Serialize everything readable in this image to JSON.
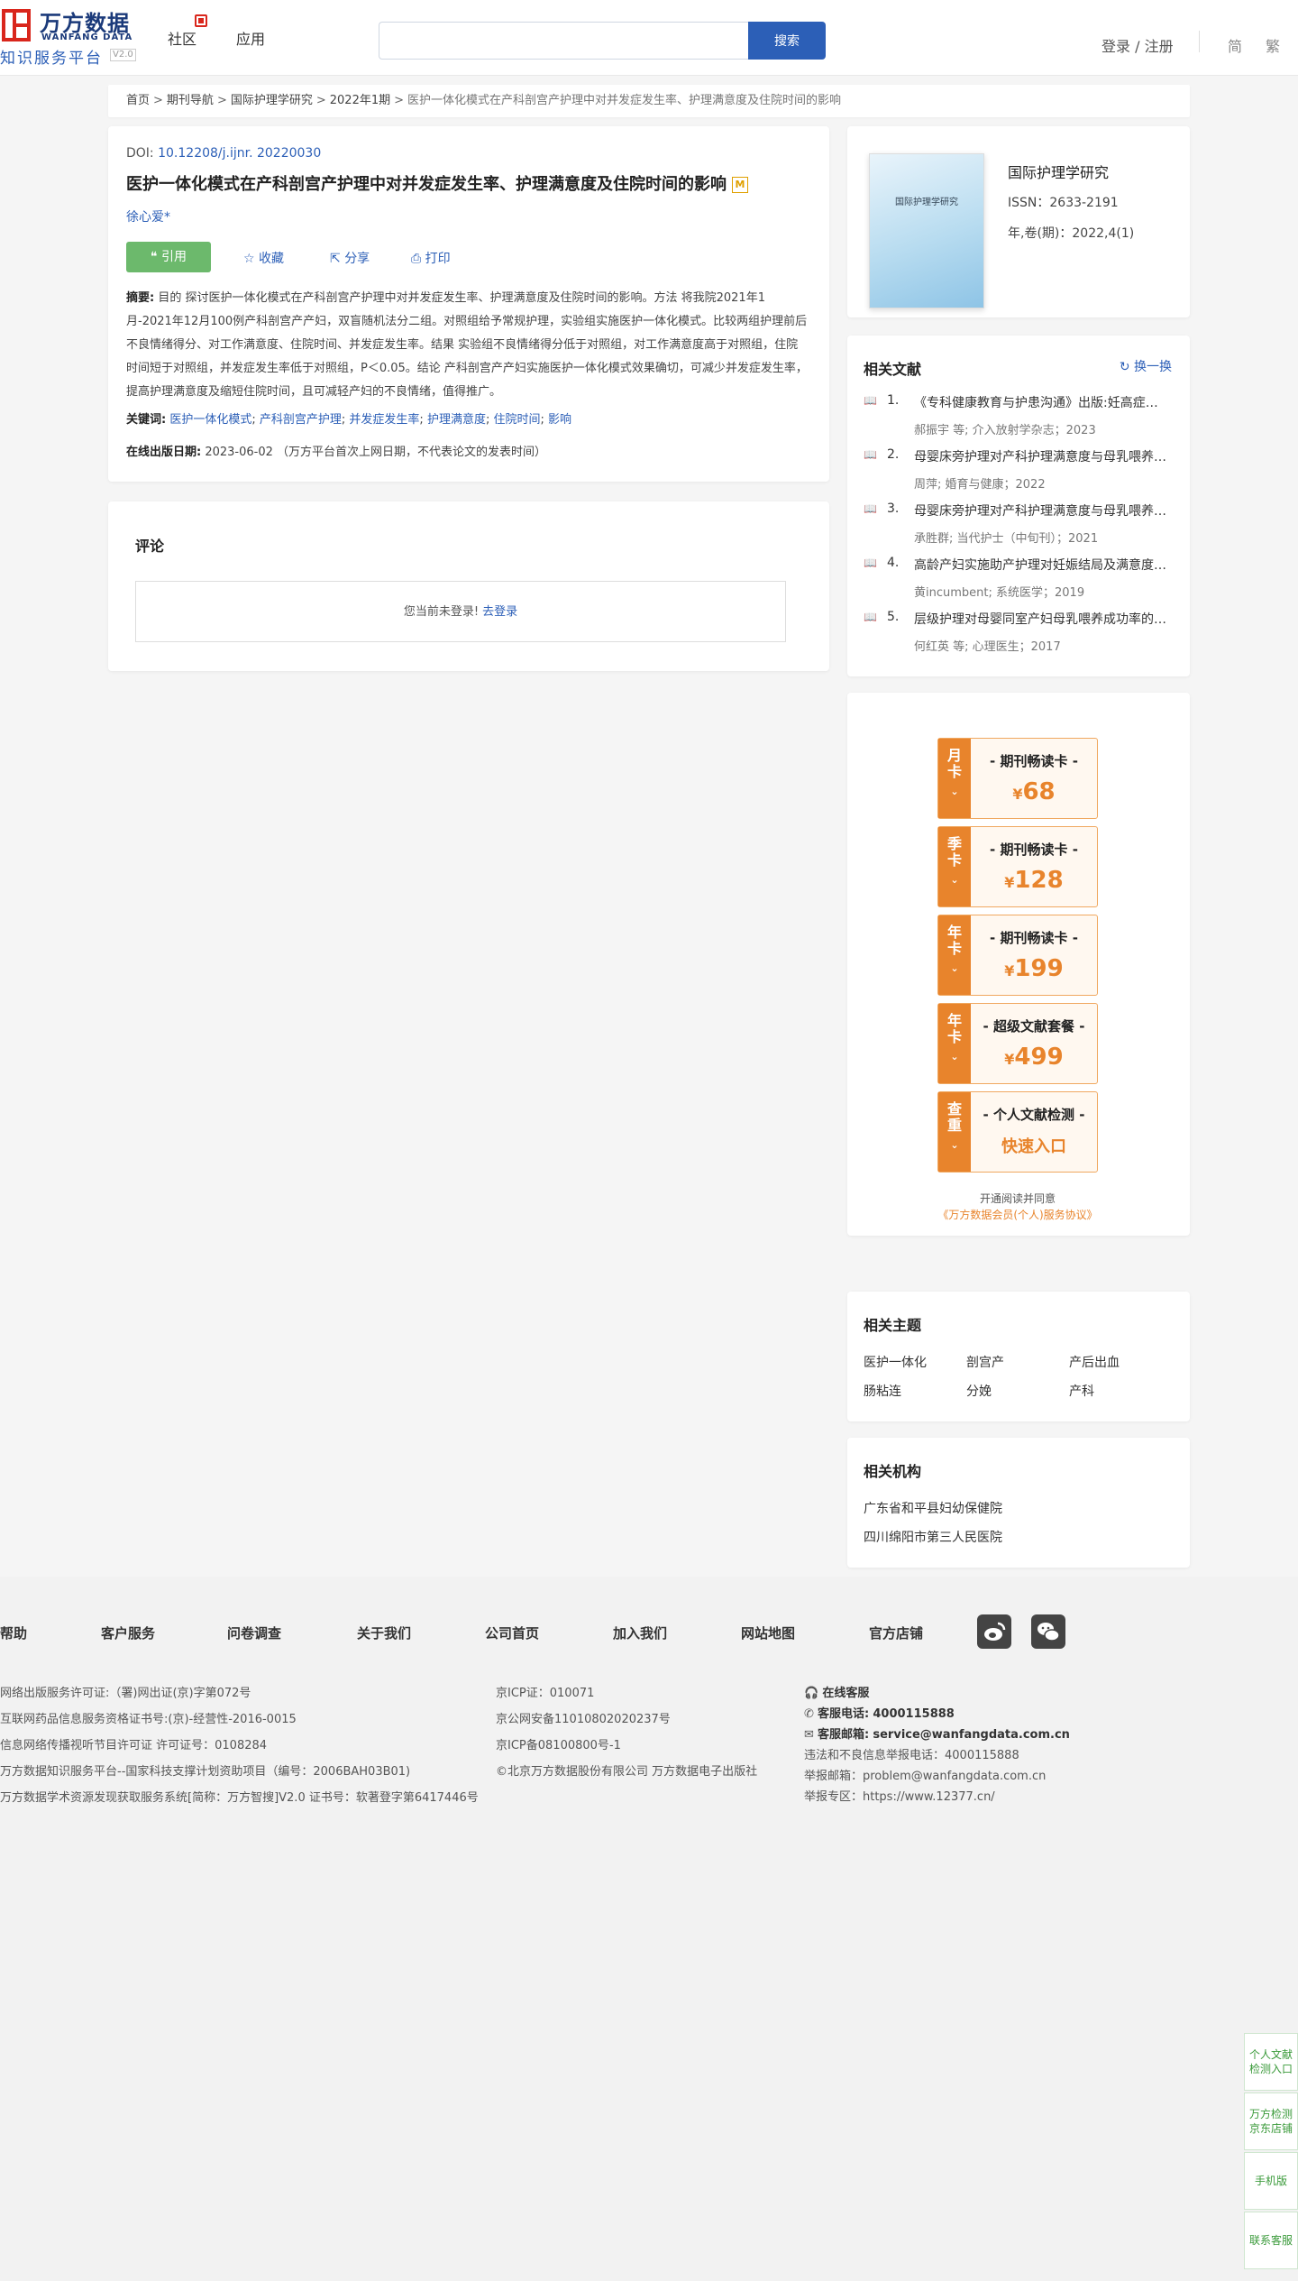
{
  "header": {
    "logo_cn": "万方数据",
    "logo_en": "WANFANG DATA",
    "logo_sub": "知识服务平台",
    "logo_ver": "V2.0",
    "nav": [
      "社区",
      "应用"
    ],
    "search_placeholder": "",
    "search_button": "搜索",
    "login": "登录 / 注册",
    "lang_simplified": "简",
    "lang_traditional": "繁"
  },
  "breadcrumb": [
    "首页",
    "期刊导航",
    "国际护理学研究",
    "2022年1期",
    "医护一体化模式在产科剖宫产护理中对并发症发生率、护理满意度及住院时间的影响"
  ],
  "article": {
    "doi_label": "DOI:",
    "doi": "10.12208/j.ijnr. 20220030",
    "title": "医护一体化模式在产科剖宫产护理中对并发症发生率、护理满意度及住院时间的影响",
    "m_badge": "M",
    "author": "徐心爱*",
    "cite": "引用",
    "actions": [
      "收藏",
      "分享",
      "打印"
    ],
    "abstract_label": "摘要:",
    "abstract": "目的 探讨医护一体化模式在产科剖宫产护理中对并发症发生率、护理满意度及住院时间的影响。方法 将我院2021年1月-2021年12月100例产科剖宫产产妇，双盲随机法分二组。对照组给予常规护理，实验组实施医护一体化模式。比较两组护理前后不良情绪得分、对工作满意度、住院时间、并发症发生率。结果 实验组不良情绪得分低于对照组，对工作满意度高于对照组，住院时间短于对照组，并发症发生率低于对照组，P＜0.05。结论 产科剖宫产产妇实施医护一体化模式效果确切，可减少并发症发生率，提高护理满意度及缩短住院时间，且可减轻产妇的不良情绪，值得推广。",
    "keywords_label": "关键词:",
    "keywords": [
      "医护一体化模式",
      "产科剖宫产护理",
      "并发症发生率",
      "护理满意度",
      "住院时间",
      "影响"
    ],
    "pubdate_label": "在线出版日期:",
    "pubdate": "2023-06-02 （万方平台首次上网日期，不代表论文的发表时间）"
  },
  "comment": {
    "heading": "评论",
    "notice": "您当前未登录!",
    "login_link": "去登录"
  },
  "journal": {
    "cover_title": "国际护理学研究",
    "name": "国际护理学研究",
    "issn": "ISSN：2633-2191",
    "issue": "年,卷(期)：2022,4(1)"
  },
  "related_docs": {
    "heading": "相关文献",
    "swap": "换一换",
    "items": [
      {
        "num": "1.",
        "title": "《专科健康教育与护患沟通》出版:妊高症孕产妇护理实践",
        "meta": "郝振宇  等;  介入放射学杂志；2023"
      },
      {
        "num": "2.",
        "title": "母婴床旁护理对产科护理满意度与母乳喂养的影响",
        "meta": "周萍; 婚育与健康；2022"
      },
      {
        "num": "3.",
        "title": "母婴床旁护理对产科护理满意度与母乳喂养的影响",
        "meta": "承胜群; 当代护士（中旬刊）；2021"
      },
      {
        "num": "4.",
        "title": "高龄产妇实施助产护理对妊娠结局及满意度的影响",
        "meta": "黄incumbent; 系统医学；2019"
      },
      {
        "num": "5.",
        "title": "层级护理对母婴同室产妇母乳喂养成功率的影响",
        "meta": "何红英  等;  心理医生；2017"
      }
    ]
  },
  "promos": [
    {
      "side": [
        "月",
        "卡"
      ],
      "label": "- 期刊畅读卡 -",
      "currency": "¥",
      "price": "68"
    },
    {
      "side": [
        "季",
        "卡"
      ],
      "label": "- 期刊畅读卡 -",
      "currency": "¥",
      "price": "128"
    },
    {
      "side": [
        "年",
        "卡"
      ],
      "label": "- 期刊畅读卡 -",
      "currency": "¥",
      "price": "199"
    },
    {
      "side": [
        "年",
        "卡"
      ],
      "label": "- 超级文献套餐 -",
      "currency": "¥",
      "price": "499"
    },
    {
      "side": [
        "查",
        "重"
      ],
      "label": "- 个人文献检测 -",
      "fast": "快速入口"
    }
  ],
  "promo_agree": {
    "line1": "开通阅读并同意",
    "line2": "《万方数据会员(个人)服务协议》"
  },
  "topics": {
    "heading": "相关主题",
    "items": [
      "医护一体化",
      "剖宫产",
      "产后出血",
      "肠粘连",
      "分娩",
      "产科"
    ]
  },
  "orgs": {
    "heading": "相关机构",
    "items": [
      "广东省和平县妇幼保健院",
      "四川绵阳市第三人民医院"
    ]
  },
  "footer": {
    "nav": [
      "帮助",
      "客户服务",
      "问卷调查",
      "关于我们",
      "公司首页",
      "加入我们",
      "网站地图",
      "官方店铺"
    ],
    "col1": [
      "网络出版服务许可证:（署)网出证(京)字第072号",
      "互联网药品信息服务资格证书号:(京)-经营性-2016-0015",
      "信息网络传播视听节目许可证 许可证号：0108284",
      "万方数据知识服务平台--国家科技支撑计划资助项目（编号：2006BAH03B01)",
      "万方数据学术资源发现获取服务系统[简称：万方智搜]V2.0 证书号：软著登字第6417446号"
    ],
    "col2": [
      "京ICP证：010071",
      "京公网安备11010802020237号",
      "京ICP备08100800号-1",
      "©北京万方数据股份有限公司 万方数据电子出版社"
    ],
    "service_label": "在线客服",
    "phone_label": "客服电话:",
    "phone": "4000115888",
    "email_label": "客服邮箱:",
    "email": "service@wanfangdata.com.cn",
    "report_phone": "违法和不良信息举报电话：4000115888",
    "report_email": "举报邮箱：problem@wanfangdata.com.cn",
    "report_zone": "举报专区：https://www.12377.cn/"
  },
  "side_float": [
    "个人文献检测入口",
    "万方检测京东店铺",
    "手机版",
    "联系客服"
  ],
  "colors": {
    "primary": "#2c5fb7",
    "accent": "#e8842c",
    "cite_green": "#6cb96c",
    "brand_red": "#d9261c"
  }
}
